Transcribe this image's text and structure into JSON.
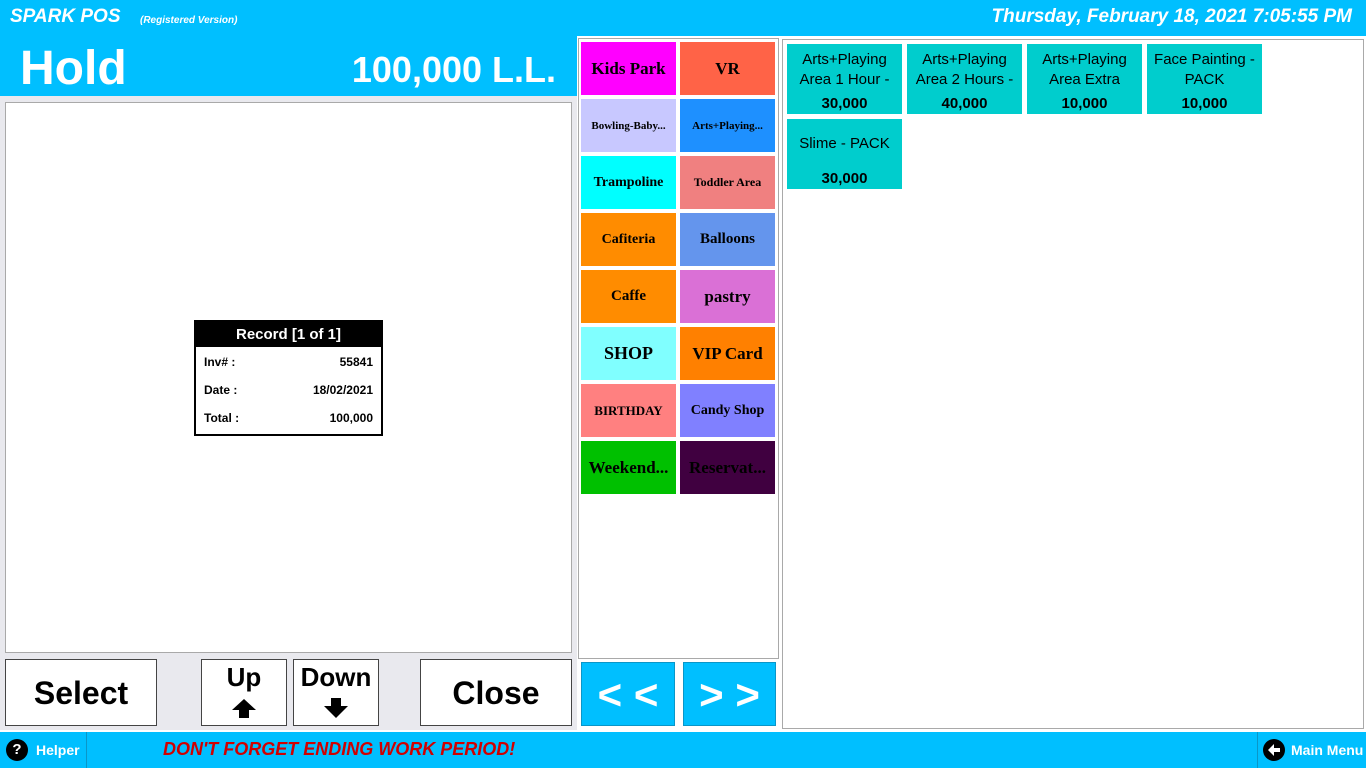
{
  "app": {
    "title": "SPARK POS",
    "subtitle": "(Registered Version)",
    "datetime": "Thursday, February 18, 2021 7:05:55 PM"
  },
  "hold": {
    "title": "Hold",
    "amount": "100,000  L.L."
  },
  "record": {
    "header": "Record [1 of 1]",
    "inv_label": "Inv# :",
    "inv_value": "55841",
    "date_label": "Date :",
    "date_value": "18/02/2021",
    "total_label": "Total :",
    "total_value": "100,000"
  },
  "buttons": {
    "select": "Select",
    "up": "Up",
    "down": "Down",
    "close": "Close",
    "prev": "< <",
    "next": "> >"
  },
  "categories": [
    {
      "label": "Kids Park",
      "color": "#ff00ff"
    },
    {
      "label": "VR",
      "color": "#ff6347"
    },
    {
      "label": "Bowling-Baby...",
      "color": "#c8c8ff"
    },
    {
      "label": "Arts+Playing...",
      "color": "#1e90ff"
    },
    {
      "label": "Trampoline",
      "color": "#00ffff"
    },
    {
      "label": "Toddler Area",
      "color": "#f08080"
    },
    {
      "label": "Cafiteria",
      "color": "#ff8c00"
    },
    {
      "label": "Balloons",
      "color": "#6495ed"
    },
    {
      "label": "Caffe",
      "color": "#ff8c00"
    },
    {
      "label": "pastry",
      "color": "#da70d6"
    },
    {
      "label": "SHOP",
      "color": "#80ffff"
    },
    {
      "label": "VIP Card",
      "color": "#ff8000"
    },
    {
      "label": "BIRTHDAY",
      "color": "#ff8080"
    },
    {
      "label": "Candy Shop",
      "color": "#8080ff"
    },
    {
      "label": "Weekend...",
      "color": "#00c000"
    },
    {
      "label": "Reservat...",
      "color": "#400040"
    }
  ],
  "products": [
    {
      "name": "Arts+Playing Area 1 Hour -",
      "price": "30,000"
    },
    {
      "name": "Arts+Playing Area 2 Hours -",
      "price": "40,000"
    },
    {
      "name": "Arts+Playing Area Extra",
      "price": "10,000"
    },
    {
      "name": "Face Painting - PACK",
      "price": "10,000"
    },
    {
      "name": "Slime - PACK",
      "price": "30,000"
    }
  ],
  "footer": {
    "helper": "Helper",
    "helper_icon": "?",
    "warning": "DON'T FORGET ENDING WORK PERIOD!",
    "main_menu": "Main Menu"
  },
  "colors": {
    "accent": "#00bfff",
    "product_tile": "#00cdcd",
    "warning_text": "#d00000"
  }
}
